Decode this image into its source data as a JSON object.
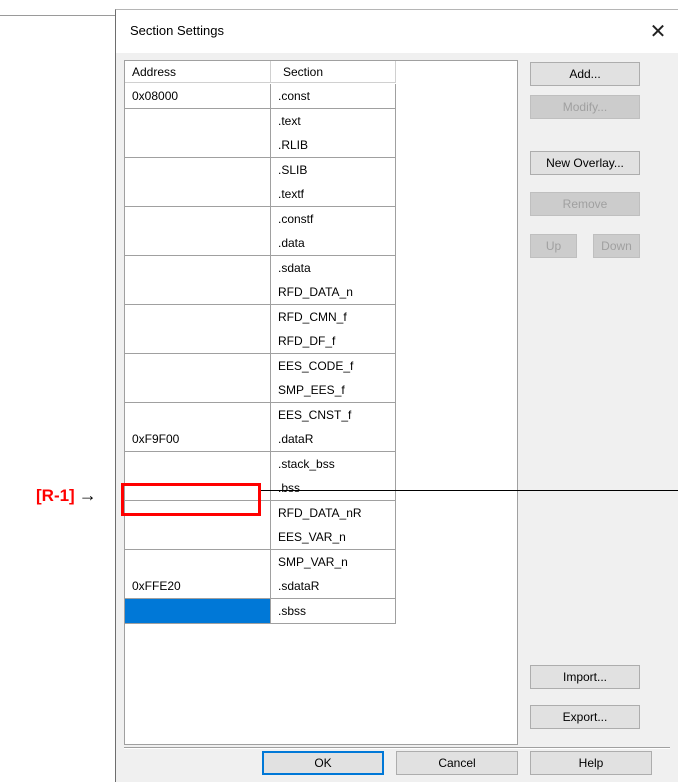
{
  "callout": {
    "label": "[R-1]",
    "arrow": "→"
  },
  "dialog": {
    "title": "Section Settings",
    "close_glyph": "✕"
  },
  "table": {
    "headers": {
      "address": "Address",
      "section": "Section"
    },
    "rows": [
      {
        "address": "0x08000",
        "section": ".const"
      },
      {
        "address": "",
        "section": ".text"
      },
      {
        "address": "",
        "section": ".RLIB"
      },
      {
        "address": "",
        "section": ".SLIB"
      },
      {
        "address": "",
        "section": ".textf"
      },
      {
        "address": "",
        "section": ".constf"
      },
      {
        "address": "",
        "section": ".data"
      },
      {
        "address": "",
        "section": ".sdata"
      },
      {
        "address": "",
        "section": "RFD_DATA_n"
      },
      {
        "address": "",
        "section": "RFD_CMN_f"
      },
      {
        "address": "",
        "section": "RFD_DF_f"
      },
      {
        "address": "",
        "section": "EES_CODE_f"
      },
      {
        "address": "",
        "section": "SMP_EES_f"
      },
      {
        "address": "",
        "section": "EES_CNST_f"
      },
      {
        "address": "0xF9F00",
        "section": ".dataR"
      },
      {
        "address": "",
        "section": ".stack_bss"
      },
      {
        "address": "",
        "section": ".bss"
      },
      {
        "address": "",
        "section": "RFD_DATA_nR"
      },
      {
        "address": "",
        "section": "EES_VAR_n"
      },
      {
        "address": "",
        "section": "SMP_VAR_n"
      },
      {
        "address": "0xFFE20",
        "section": ".sdataR"
      },
      {
        "address": "",
        "section": ".sbss"
      }
    ],
    "selected_row": 21,
    "highlighted_row": 14
  },
  "buttons": {
    "add": "Add...",
    "modify": "Modify...",
    "new_overlay": "New Overlay...",
    "remove": "Remove",
    "up": "Up",
    "down": "Down",
    "import": "Import...",
    "export": "Export...",
    "ok": "OK",
    "cancel": "Cancel",
    "help": "Help"
  },
  "colors": {
    "selection": "#0078d7",
    "highlight_box": "#ff0000",
    "callout_text": "#ff0000"
  }
}
